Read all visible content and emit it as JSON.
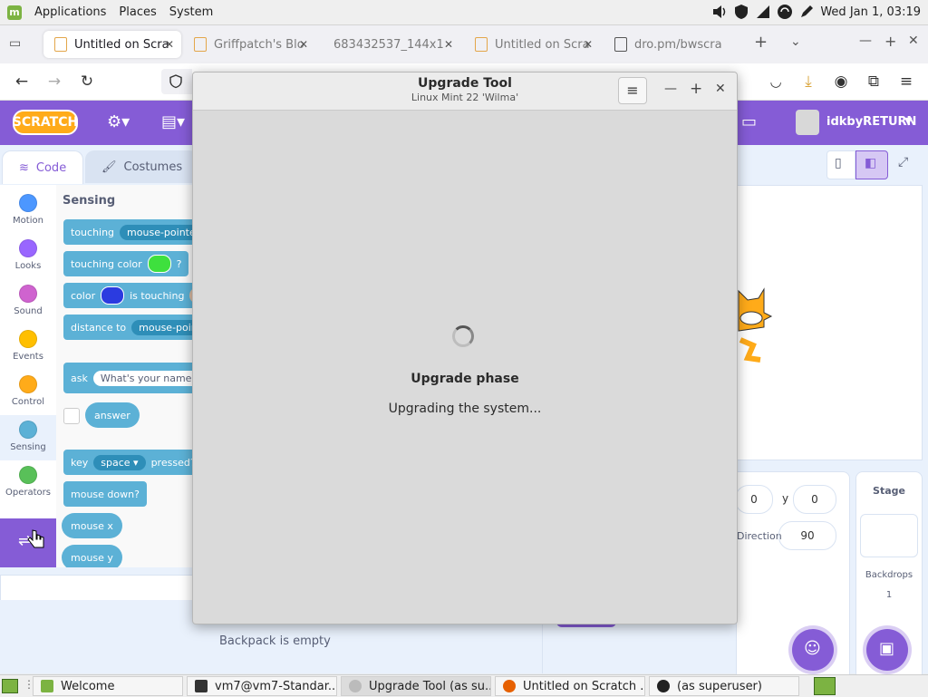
{
  "desktop_panel": {
    "menu": [
      "Applications",
      "Places",
      "System"
    ],
    "clock": "Wed Jan  1, 03:19"
  },
  "browser": {
    "tabs": [
      {
        "label": "Untitled on Scra",
        "active": true
      },
      {
        "label": "Griffpatch's Blo"
      },
      {
        "label": "683432537_144x1"
      },
      {
        "label": "Untitled on Scra"
      },
      {
        "label": "dro.pm/bwscra"
      }
    ],
    "new_tab": "+"
  },
  "scratch": {
    "username": "idkbyRETURN",
    "tabs": {
      "code": "Code",
      "costumes": "Costumes"
    },
    "categories": [
      {
        "label": "Motion",
        "color": "#4c97ff"
      },
      {
        "label": "Looks",
        "color": "#9966ff"
      },
      {
        "label": "Sound",
        "color": "#cf63cf"
      },
      {
        "label": "Events",
        "color": "#ffbf00"
      },
      {
        "label": "Control",
        "color": "#ffab19"
      },
      {
        "label": "Sensing",
        "color": "#5cb1d6"
      },
      {
        "label": "Operators",
        "color": "#59c059"
      }
    ],
    "palette_heading": "Sensing",
    "blocks": {
      "touching": "touching",
      "touching_target": "mouse-pointer",
      "touching_color": "touching color",
      "q": "?",
      "color": "color",
      "is_touching": "is touching",
      "distance_to": "distance to",
      "distance_target": "mouse-pointer",
      "ask": "ask",
      "ask_prompt": "What's your name?",
      "answer": "answer",
      "key": "key",
      "key_value": "space",
      "pressed": "pressed?",
      "mouse_down": "mouse down?",
      "mouse_x": "mouse x",
      "mouse_y": "mouse y"
    },
    "sprite_info": {
      "x": "0",
      "y_label": "y",
      "y": "0",
      "direction_label": "Direction",
      "direction": "90"
    },
    "stage_panel": {
      "title": "Stage",
      "backdrops_label": "Backdrops",
      "backdrops_count": "1"
    },
    "backpack": "Backpack is empty"
  },
  "dialog": {
    "title": "Upgrade Tool",
    "subtitle": "Linux Mint 22 'Wilma'",
    "menu_icon": "≡",
    "phase": "Upgrade phase",
    "status": "Upgrading the system..."
  },
  "taskbar": {
    "items": [
      {
        "label": "Welcome"
      },
      {
        "label": "vm7@vm7-Standar..."
      },
      {
        "label": "Upgrade Tool (as su...",
        "active": true
      },
      {
        "label": "Untitled on Scratch ..."
      },
      {
        "label": "(as superuser)"
      }
    ]
  }
}
